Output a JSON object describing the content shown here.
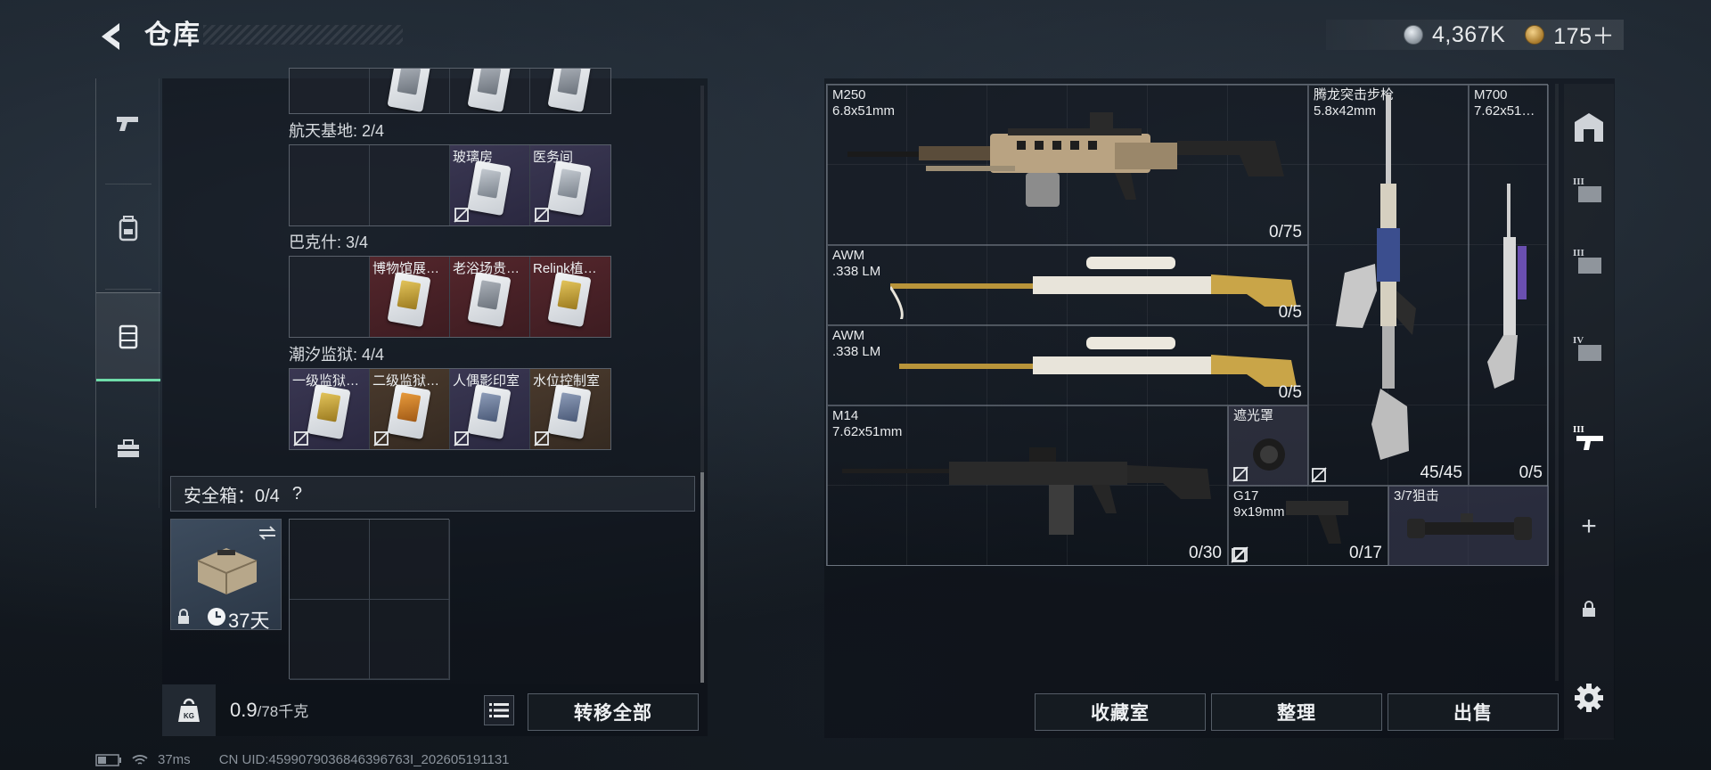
{
  "header": {
    "title": "仓库",
    "currency_silver": "4,367K",
    "currency_gold": "175＋"
  },
  "left_nav": {
    "items": [
      "pistol-icon",
      "backpack-icon",
      "container-icon",
      "toolbox-icon"
    ],
    "active": "container-icon",
    "accent_color": "#6fdca9"
  },
  "sections": [
    {
      "title": "",
      "cells": [
        {
          "label": ""
        },
        {
          "label": ""
        },
        {
          "label": ""
        },
        {
          "label": ""
        }
      ]
    },
    {
      "title": "航天基地: 2/4",
      "cells": [
        {
          "label": ""
        },
        {
          "label": ""
        },
        {
          "label": "玻璃房"
        },
        {
          "label": "医务间"
        }
      ]
    },
    {
      "title": "巴克什: 3/4",
      "cells": [
        {
          "label": ""
        },
        {
          "label": "博物馆展…"
        },
        {
          "label": "老浴场贵…"
        },
        {
          "label": "Relink植…"
        }
      ]
    },
    {
      "title": "潮汐监狱: 4/4",
      "cells": [
        {
          "label": "一级监狱…"
        },
        {
          "label": "二级监狱…"
        },
        {
          "label": "人偶影印室"
        },
        {
          "label": "水位控制室"
        }
      ]
    }
  ],
  "safe_box": {
    "label": "安全箱：0/4",
    "help": "?",
    "duration": "37天"
  },
  "weight": {
    "current": "0.9",
    "max": "/78千克",
    "kg_icon_label": "KG"
  },
  "buttons": {
    "transfer_all": "转移全部",
    "collection": "收藏室",
    "sort": "整理",
    "sell": "出售"
  },
  "weapons": [
    {
      "name": "M250",
      "caliber": "6.8x51mm",
      "ammo": "0/75"
    },
    {
      "name": "腾龙突击步枪",
      "caliber": "5.8x42mm",
      "ammo": "45/45"
    },
    {
      "name": "M700",
      "caliber": "7.62x51…",
      "ammo": "0/5"
    },
    {
      "name": "AWM",
      "caliber": ".338 LM",
      "ammo": "0/5"
    },
    {
      "name": "AWM",
      "caliber": ".338 LM",
      "ammo": "0/5"
    },
    {
      "name": "M14",
      "caliber": "7.62x51mm",
      "ammo": "0/30"
    },
    {
      "name": "遮光罩",
      "caliber": "",
      "ammo": ""
    },
    {
      "name": "G17",
      "caliber": "9x19mm",
      "ammo": "0/17"
    },
    {
      "name": "3/7狙击",
      "caliber": "",
      "ammo": ""
    }
  ],
  "right_nav": {
    "items": [
      "home-base-icon",
      "tier-3-armor-icon",
      "tier-3-armor-icon",
      "tier-4-armor-icon",
      "tier-3-weapon-icon",
      "plus-icon",
      "lock-icon"
    ],
    "roman_labels": [
      "III",
      "III",
      "IV",
      "III"
    ],
    "plus": "+",
    "settings": "gear-icon"
  },
  "footer": {
    "ping": "37ms",
    "uid": "CN UID:4599079036846396763I_202605191131"
  }
}
